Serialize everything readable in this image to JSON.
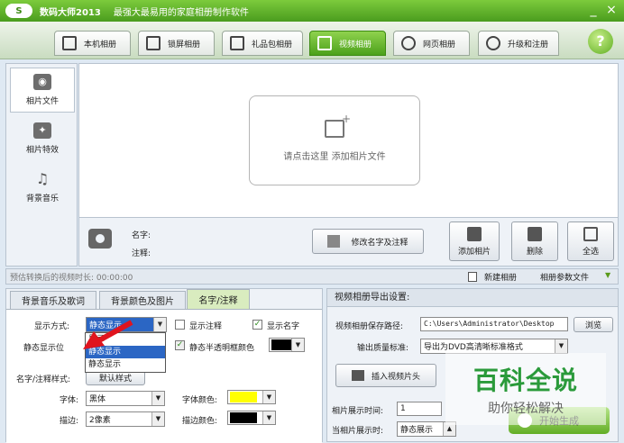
{
  "window": {
    "logo": "S",
    "title": "数码大师2013",
    "slogan": "最强大最易用的家庭相册制作软件",
    "min_btn": "_",
    "close_btn": "×"
  },
  "nav": {
    "tabs": [
      "本机相册",
      "锁屏相册",
      "礼品包相册",
      "视频相册",
      "网页相册",
      "升级和注册"
    ],
    "active": "视频相册",
    "help": "?"
  },
  "sidebar": {
    "items": [
      {
        "label": "相片文件",
        "icon": "camera-icon"
      },
      {
        "label": "相片特效",
        "icon": "sparkle-icon"
      },
      {
        "label": "背景音乐",
        "icon": "music-note-icon"
      }
    ]
  },
  "main": {
    "add_photo_text": "请点击这里  添加相片文件"
  },
  "info": {
    "name_label": "名字:",
    "note_label": "注释:",
    "edit_button": "修改名字及注释",
    "add_photo": "添加相片",
    "delete": "删除",
    "select_all": "全选"
  },
  "status": {
    "duration": "预估转换后的视频时长: 00:00:00",
    "new_album": "新建相册",
    "album_params": "相册参数文件"
  },
  "left": {
    "tabs": [
      "背景音乐及歌词",
      "背景颜色及图片",
      "名字/注释"
    ],
    "active_tab": "名字/注释",
    "display_mode_label": "显示方式:",
    "display_mode_value": "静态显示",
    "dropdown_options": [
      "显示",
      "静态显示",
      "静态显示"
    ],
    "show_note_label": "显示注释",
    "show_name_label": "显示名字",
    "static_pos_label": "静态显示位",
    "semi_transparent_label": "静态半透明框颜色",
    "name_style_label": "名字/注释样式:",
    "default_style_btn": "默认样式",
    "font_label": "字体:",
    "font_value": "黑体",
    "font_color_label": "字体颜色:",
    "stroke_label": "描边:",
    "stroke_value": "2像素",
    "stroke_color_label": "描边颜色:",
    "colors": {
      "font_color": "#ffff00",
      "frame_color": "#000000",
      "stroke_color": "#000000"
    }
  },
  "right": {
    "header": "视频相册导出设置:",
    "save_path_label": "视频相册保存路径:",
    "save_path_value": "C:\\Users\\Administrator\\Desktop",
    "browse": "浏览",
    "quality_label": "输出质量标准:",
    "quality_value": "导出为DVD高清晰标准格式",
    "insert_header": "插入视频片头",
    "display_time_label": "相片展示时间:",
    "display_time_value": "1",
    "current_label": "当相片展示时:",
    "current_value": "静态展示",
    "start": "开始生成"
  },
  "watermark": {
    "title": "百科全说",
    "subtitle": "助你轻松解决"
  }
}
